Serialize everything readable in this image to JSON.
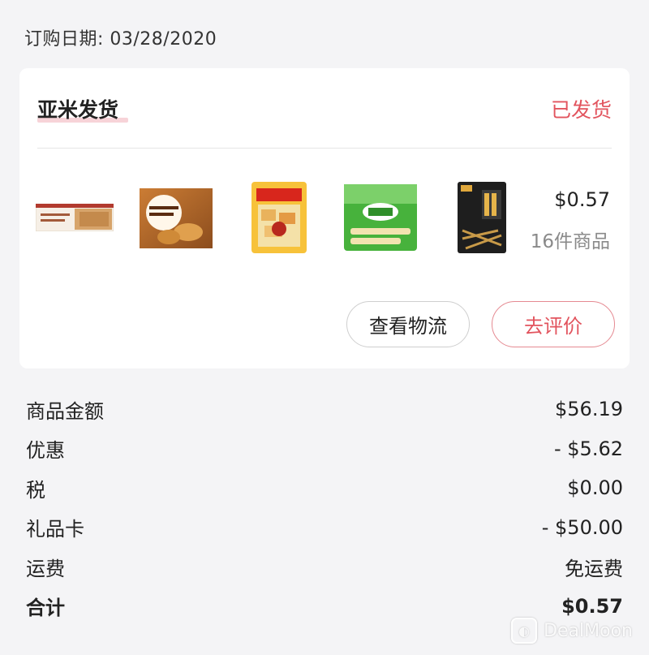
{
  "order": {
    "date_label": "订购日期: 03/28/2020"
  },
  "card": {
    "seller": "亚米发货",
    "status": "已发货",
    "price": "$0.57",
    "item_count": "16件商品",
    "products": [
      {
        "icon": "sultana-biscuits-product-image",
        "lettering": "Sultana Biscuits"
      },
      {
        "icon": "chestnut-rice-cake-cookie-product-image",
        "lettering": "Chestnut Rice cake cookie"
      },
      {
        "icon": "snack-bag-product-image"
      },
      {
        "icon": "lipo-cookies-product-image",
        "lettering": "LIPO"
      },
      {
        "icon": "spicy-snack-bag-product-image"
      }
    ],
    "buttons": {
      "track": "查看物流",
      "review": "去评价"
    }
  },
  "summary": {
    "rows": [
      {
        "label": "商品金额",
        "value": "$56.19"
      },
      {
        "label": "优惠",
        "value": "- $5.62"
      },
      {
        "label": "税",
        "value": "$0.00"
      },
      {
        "label": "礼品卡",
        "value": "- $50.00"
      },
      {
        "label": "运费",
        "value": "免运费"
      }
    ],
    "total": {
      "label": "合计",
      "value": "$0.57"
    }
  },
  "watermark": {
    "text": "DealMoon"
  },
  "colors": {
    "accent": "#e2545e",
    "accent_border": "#e58a92",
    "background": "#f4f4f6",
    "card": "#ffffff"
  }
}
